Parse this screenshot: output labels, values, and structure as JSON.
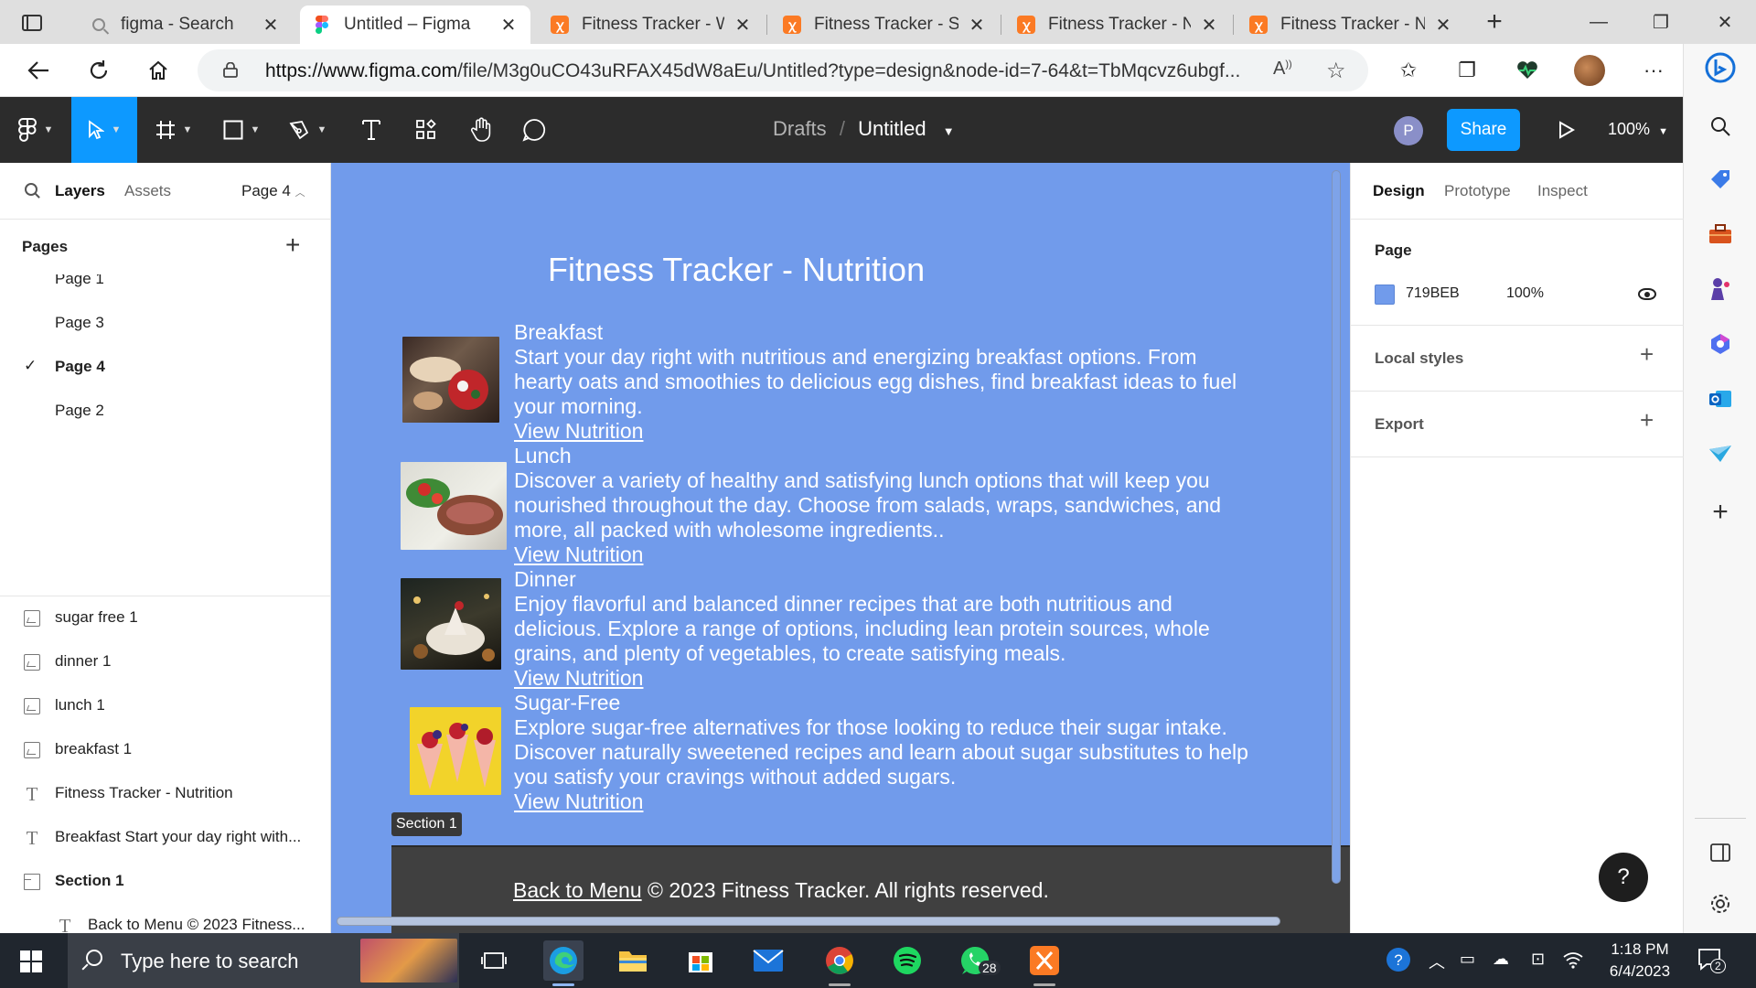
{
  "browser": {
    "tabs": [
      {
        "title": "figma - Search",
        "icon": "search-icon",
        "active": false
      },
      {
        "title": "Untitled – Figma",
        "icon": "figma-icon",
        "active": true
      },
      {
        "title": "Fitness Tracker - Wa",
        "icon": "xampp-icon",
        "active": false
      },
      {
        "title": "Fitness Tracker - Str",
        "icon": "xampp-icon",
        "active": false
      },
      {
        "title": "Fitness Tracker - Nu",
        "icon": "xampp-icon",
        "active": false
      },
      {
        "title": "Fitness Tracker - Nu",
        "icon": "xampp-icon",
        "active": false
      }
    ],
    "url_host": "https://www.figma.com",
    "url_path": "/file/M3g0uCO43uRFAX45dW8aEu/Untitled?type=design&node-id=7-64&t=TbMqcvz6ubgf..."
  },
  "figma": {
    "toolbar": {
      "breadcrumb_parent": "Drafts",
      "breadcrumb_sep": "/",
      "file_name": "Untitled",
      "avatar_initial": "P",
      "share_label": "Share",
      "zoom": "100%"
    },
    "left_panel": {
      "tab_layers": "Layers",
      "tab_assets": "Assets",
      "page_selector": "Page 4",
      "pages_heading": "Pages",
      "pages": [
        {
          "name": "Page 1",
          "selected": false
        },
        {
          "name": "Page 3",
          "selected": false
        },
        {
          "name": "Page 4",
          "selected": true
        },
        {
          "name": "Page 2",
          "selected": false
        }
      ],
      "layers": [
        {
          "name": "sugar free 1",
          "type": "image"
        },
        {
          "name": "dinner 1",
          "type": "image"
        },
        {
          "name": "lunch 1",
          "type": "image"
        },
        {
          "name": "breakfast 1",
          "type": "image"
        },
        {
          "name": "Fitness Tracker - Nutrition",
          "type": "text"
        },
        {
          "name": "Breakfast Start your day right with...",
          "type": "text"
        },
        {
          "name": "Section 1",
          "type": "section"
        },
        {
          "name": "Back to Menu © 2023 Fitness...",
          "type": "text"
        }
      ]
    },
    "canvas": {
      "background": "#719BEB",
      "title": "Fitness Tracker - Nutrition",
      "meals": [
        {
          "name": "Breakfast",
          "description": "Start your day right with nutritious and energizing breakfast options. From hearty oats and smoothies to delicious egg dishes, find breakfast ideas to fuel your morning.",
          "link": "View Nutrition"
        },
        {
          "name": "Lunch",
          "description": "Discover a variety of healthy and satisfying lunch options that will keep you nourished throughout the day. Choose from salads, wraps, sandwiches, and more, all packed with wholesome ingredients..",
          "link": "View Nutrition"
        },
        {
          "name": "Dinner",
          "description": "Enjoy flavorful and balanced dinner recipes that are both nutritious and delicious. Explore a range of options, including lean protein sources, whole grains, and plenty of vegetables, to create satisfying meals.",
          "link": "View Nutrition"
        },
        {
          "name": "Sugar-Free",
          "description": "Explore sugar-free alternatives for those looking to reduce their sugar intake. Discover naturally sweetened recipes and learn about sugar substitutes to help you satisfy your cravings without added sugars.",
          "link": "View Nutrition"
        }
      ],
      "section_label": "Section 1",
      "footer_link": "Back to Menu",
      "footer_text": " © 2023 Fitness Tracker. All rights reserved."
    },
    "right_panel": {
      "tabs": [
        "Design",
        "Prototype",
        "Inspect"
      ],
      "page_heading": "Page",
      "page_color_hex": "719BEB",
      "page_opacity": "100%",
      "local_styles": "Local styles",
      "export": "Export",
      "help": "?"
    }
  },
  "taskbar": {
    "search_placeholder": "Type here to search",
    "whatsapp_badge": "28",
    "time": "1:18 PM",
    "date": "6/4/2023",
    "notifications": "2"
  }
}
